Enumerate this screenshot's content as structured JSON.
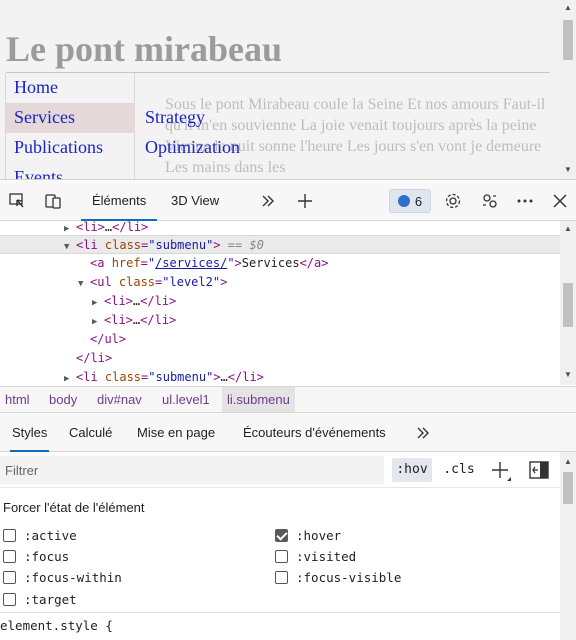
{
  "page": {
    "title": "Le pont mirabeau",
    "nav": [
      "Home",
      "Services",
      "Publications",
      "Events"
    ],
    "subnav": [
      "Strategy",
      "Optimization"
    ],
    "poem": "Sous le pont Mirabeau coule la Seine Et nos amours Faut-il qu'il m'en souvienne La joie venait toujours après la peine Vienne la nuit sonne l'heure Les jours s'en vont je demeure Les mains dans les"
  },
  "toolbar": {
    "tabs": [
      "Éléments",
      "3D View"
    ],
    "issues_count": "6",
    "icons": [
      "inspect-icon",
      "device-toggle-icon",
      "more-tabs-icon",
      "add-tab-icon",
      "issues-icon",
      "settings-icon",
      "connect-icon",
      "more-menu-icon",
      "close-icon"
    ]
  },
  "dom": {
    "ellipsis": "…",
    "selected_marker": "== $0",
    "lines": [
      {
        "open": "<li>",
        "close": "</li>"
      },
      {
        "tag_open": "<li ",
        "attr": "class",
        "val": "\"submenu\"",
        "tag_close": ">"
      },
      {
        "tag_open": "<a ",
        "attr": "href",
        "val_q1": "\"",
        "link": "/services/",
        "val_q2": "\"",
        "tag_close": ">",
        "text": "Services",
        "end": "</a>"
      },
      {
        "tag_open": "<ul ",
        "attr": "class",
        "val": "\"level2\"",
        "tag_close": ">"
      },
      {
        "open": "<li>",
        "close": "</li>"
      },
      {
        "open": "<li>",
        "close": "</li>"
      },
      {
        "end": "</ul>"
      },
      {
        "end": "</li>"
      },
      {
        "tag_open": "<li ",
        "attr": "class",
        "val": "\"submenu\"",
        "tag_close": ">",
        "close": "</li>"
      }
    ]
  },
  "breadcrumb": [
    "html",
    "body",
    "div#nav",
    "ul.level1",
    "li.submenu"
  ],
  "styles_pane": {
    "tabs": [
      "Styles",
      "Calculé",
      "Mise en page",
      "Écouteurs d'événements"
    ],
    "filter_placeholder": "Filtrer",
    "hov_label": ":hov",
    "cls_label": ".cls",
    "force_state_title": "Forcer l'état de l'élément",
    "states": [
      {
        "label": ":active",
        "checked": false
      },
      {
        "label": ":hover",
        "checked": true
      },
      {
        "label": ":focus",
        "checked": false
      },
      {
        "label": ":visited",
        "checked": false
      },
      {
        "label": ":focus-within",
        "checked": false
      },
      {
        "label": ":focus-visible",
        "checked": false
      },
      {
        "label": ":target",
        "checked": false
      }
    ],
    "element_style": "element.style {"
  }
}
